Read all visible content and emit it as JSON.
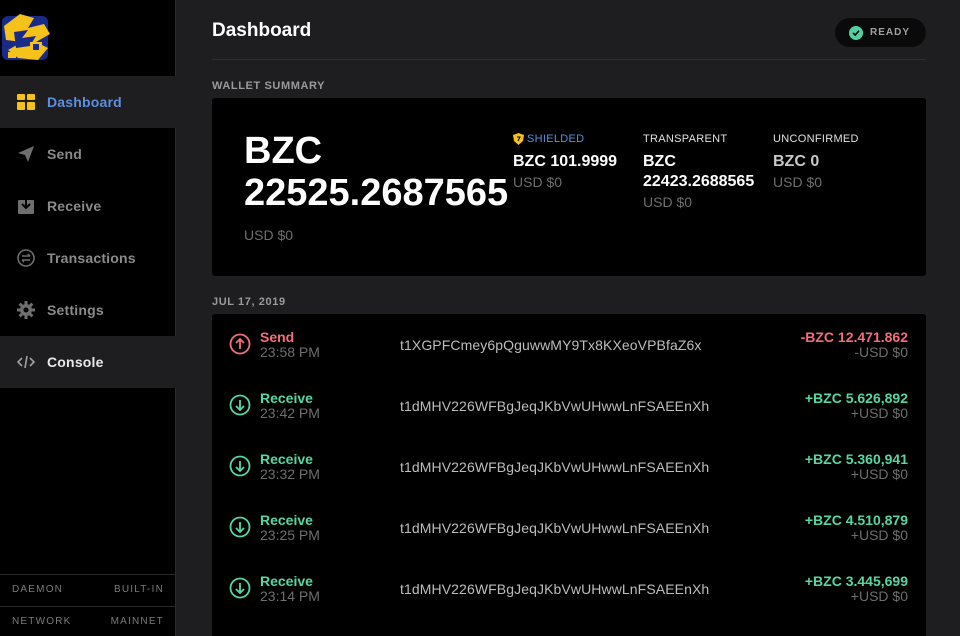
{
  "colors": {
    "accent": "#5c8fe0",
    "send": "#f0707a",
    "receive": "#57d6a3",
    "ready": "#4fd1a1",
    "logo_yellow": "#f4c21b"
  },
  "sidebar": {
    "logo_icon": "zcash-style-logo-icon",
    "items": [
      {
        "label": "Dashboard",
        "icon": "dashboard-icon",
        "active": true
      },
      {
        "label": "Send",
        "icon": "paper-plane-icon"
      },
      {
        "label": "Receive",
        "icon": "inbox-download-icon"
      },
      {
        "label": "Transactions",
        "icon": "exchange-icon"
      },
      {
        "label": "Settings",
        "icon": "gear-icon"
      },
      {
        "label": "Console",
        "icon": "code-icon"
      }
    ],
    "status": {
      "daemon_label": "DAEMON",
      "daemon_value": "BUILT-IN",
      "network_label": "NETWORK",
      "network_value": "MAINNET"
    }
  },
  "header": {
    "title": "Dashboard",
    "status_badge": "READY"
  },
  "summary": {
    "section_label": "WALLET SUMMARY",
    "total_amount": "BZC 22525.2687565",
    "total_usd": "USD $0",
    "shielded": {
      "label": "SHIELDED",
      "amount": "BZC 101.9999",
      "usd": "USD $0"
    },
    "transparent": {
      "label": "TRANSPARENT",
      "amount": "BZC 22423.2688565",
      "usd": "USD $0"
    },
    "unconfirmed": {
      "label": "UNCONFIRMED",
      "amount": "BZC 0",
      "usd": "USD $0"
    }
  },
  "transactions": {
    "date_label": "JUL 17, 2019",
    "rows": [
      {
        "type": "Send",
        "time": "23:58 PM",
        "address": "t1XGPFCmey6pQguwwMY9Tx8KXeoVPBfaZ6x",
        "amount": "-BZC 12.471.862",
        "usd": "-USD $0"
      },
      {
        "type": "Receive",
        "time": "23:42 PM",
        "address": "t1dMHV226WFBgJeqJKbVwUHwwLnFSAEEnXh",
        "amount": "+BZC 5.626,892",
        "usd": "+USD $0"
      },
      {
        "type": "Receive",
        "time": "23:32 PM",
        "address": "t1dMHV226WFBgJeqJKbVwUHwwLnFSAEEnXh",
        "amount": "+BZC 5.360,941",
        "usd": "+USD $0"
      },
      {
        "type": "Receive",
        "time": "23:25 PM",
        "address": "t1dMHV226WFBgJeqJKbVwUHwwLnFSAEEnXh",
        "amount": "+BZC 4.510,879",
        "usd": "+USD $0"
      },
      {
        "type": "Receive",
        "time": "23:14 PM",
        "address": "t1dMHV226WFBgJeqJKbVwUHwwLnFSAEEnXh",
        "amount": "+BZC 3.445,699",
        "usd": "+USD $0"
      }
    ]
  }
}
